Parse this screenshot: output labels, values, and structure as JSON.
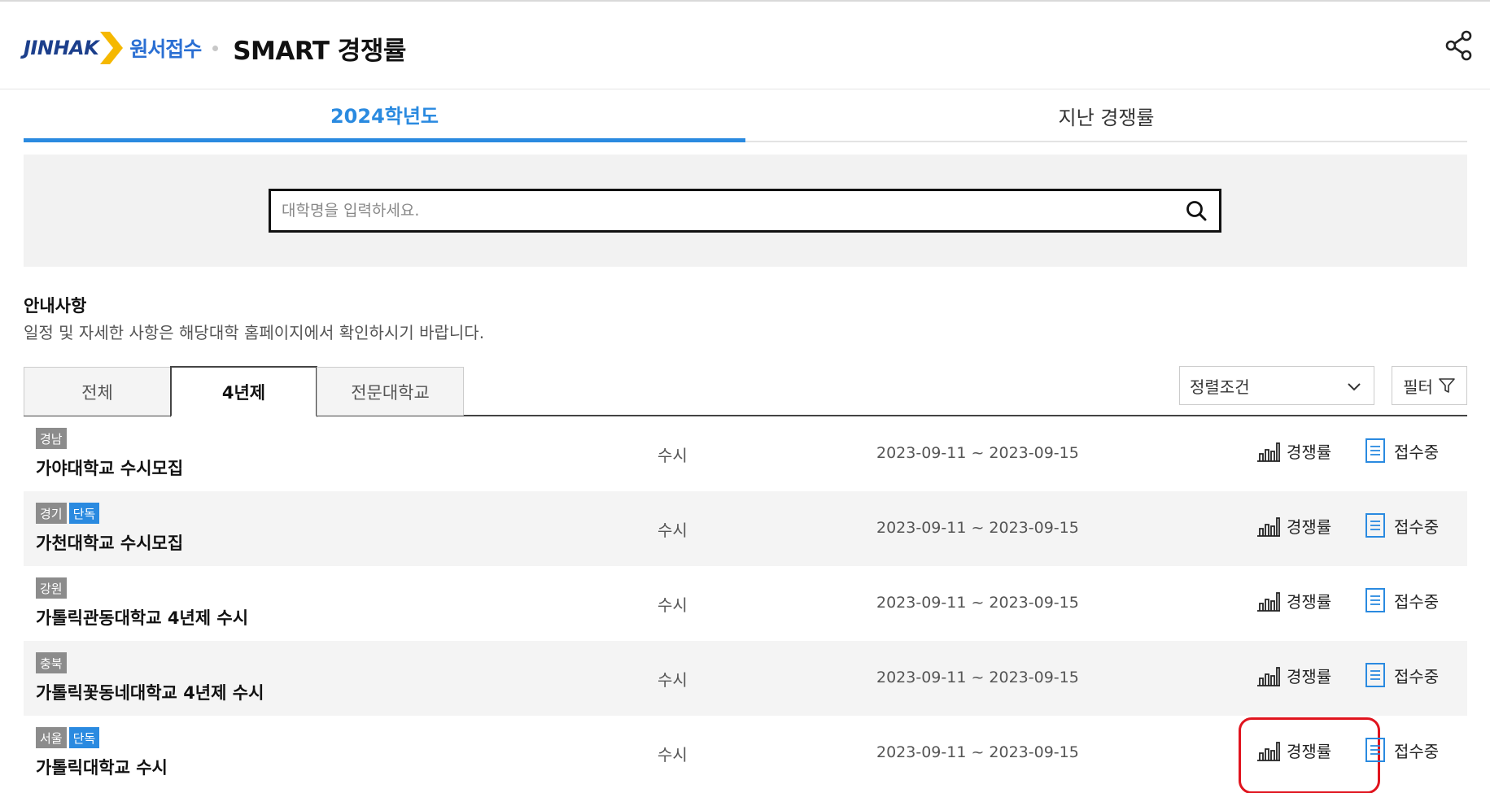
{
  "header": {
    "logo_text": "JINHAK",
    "brand_sub": "원서접수",
    "title": "SMART 경쟁률"
  },
  "year_tabs": [
    {
      "label": "2024학년도",
      "active": true
    },
    {
      "label": "지난 경쟁률",
      "active": false
    }
  ],
  "search": {
    "placeholder": "대학명을 입력하세요.",
    "value": ""
  },
  "notice": {
    "title": "안내사항",
    "text": "일정 및 자세한 사항은 해당대학 홈페이지에서 확인하시기 바랍니다."
  },
  "type_tabs": [
    {
      "label": "전체",
      "active": false
    },
    {
      "label": "4년제",
      "active": true
    },
    {
      "label": "전문대학교",
      "active": false
    }
  ],
  "sort": {
    "label": "정렬조건"
  },
  "filter": {
    "label": "필터"
  },
  "rows": [
    {
      "region": "경남",
      "solo": "",
      "name": "가야대학교 수시모집",
      "type": "수시",
      "period": "2023-09-11 ~ 2023-09-15",
      "rate_label": "경쟁률",
      "status": "접수중"
    },
    {
      "region": "경기",
      "solo": "단독",
      "name": "가천대학교 수시모집",
      "type": "수시",
      "period": "2023-09-11 ~ 2023-09-15",
      "rate_label": "경쟁률",
      "status": "접수중"
    },
    {
      "region": "강원",
      "solo": "",
      "name": "가톨릭관동대학교 4년제 수시",
      "type": "수시",
      "period": "2023-09-11 ~ 2023-09-15",
      "rate_label": "경쟁률",
      "status": "접수중"
    },
    {
      "region": "충북",
      "solo": "",
      "name": "가톨릭꽃동네대학교 4년제 수시",
      "type": "수시",
      "period": "2023-09-11 ~ 2023-09-15",
      "rate_label": "경쟁률",
      "status": "접수중"
    },
    {
      "region": "서울",
      "solo": "단독",
      "name": "가톨릭대학교 수시",
      "type": "수시",
      "period": "2023-09-11 ~ 2023-09-15",
      "rate_label": "경쟁률",
      "status": "접수중"
    }
  ],
  "colors": {
    "accent": "#2a8ae0",
    "brand_blue": "#1c3f8c",
    "logo_arrow": "#f5b800",
    "highlight": "#e0141e"
  },
  "icons": {
    "share": "share-icon",
    "search": "search-icon",
    "rate": "bar-chart-icon",
    "status": "document-icon",
    "filter": "funnel-icon",
    "sort": "chevron-down-icon"
  }
}
